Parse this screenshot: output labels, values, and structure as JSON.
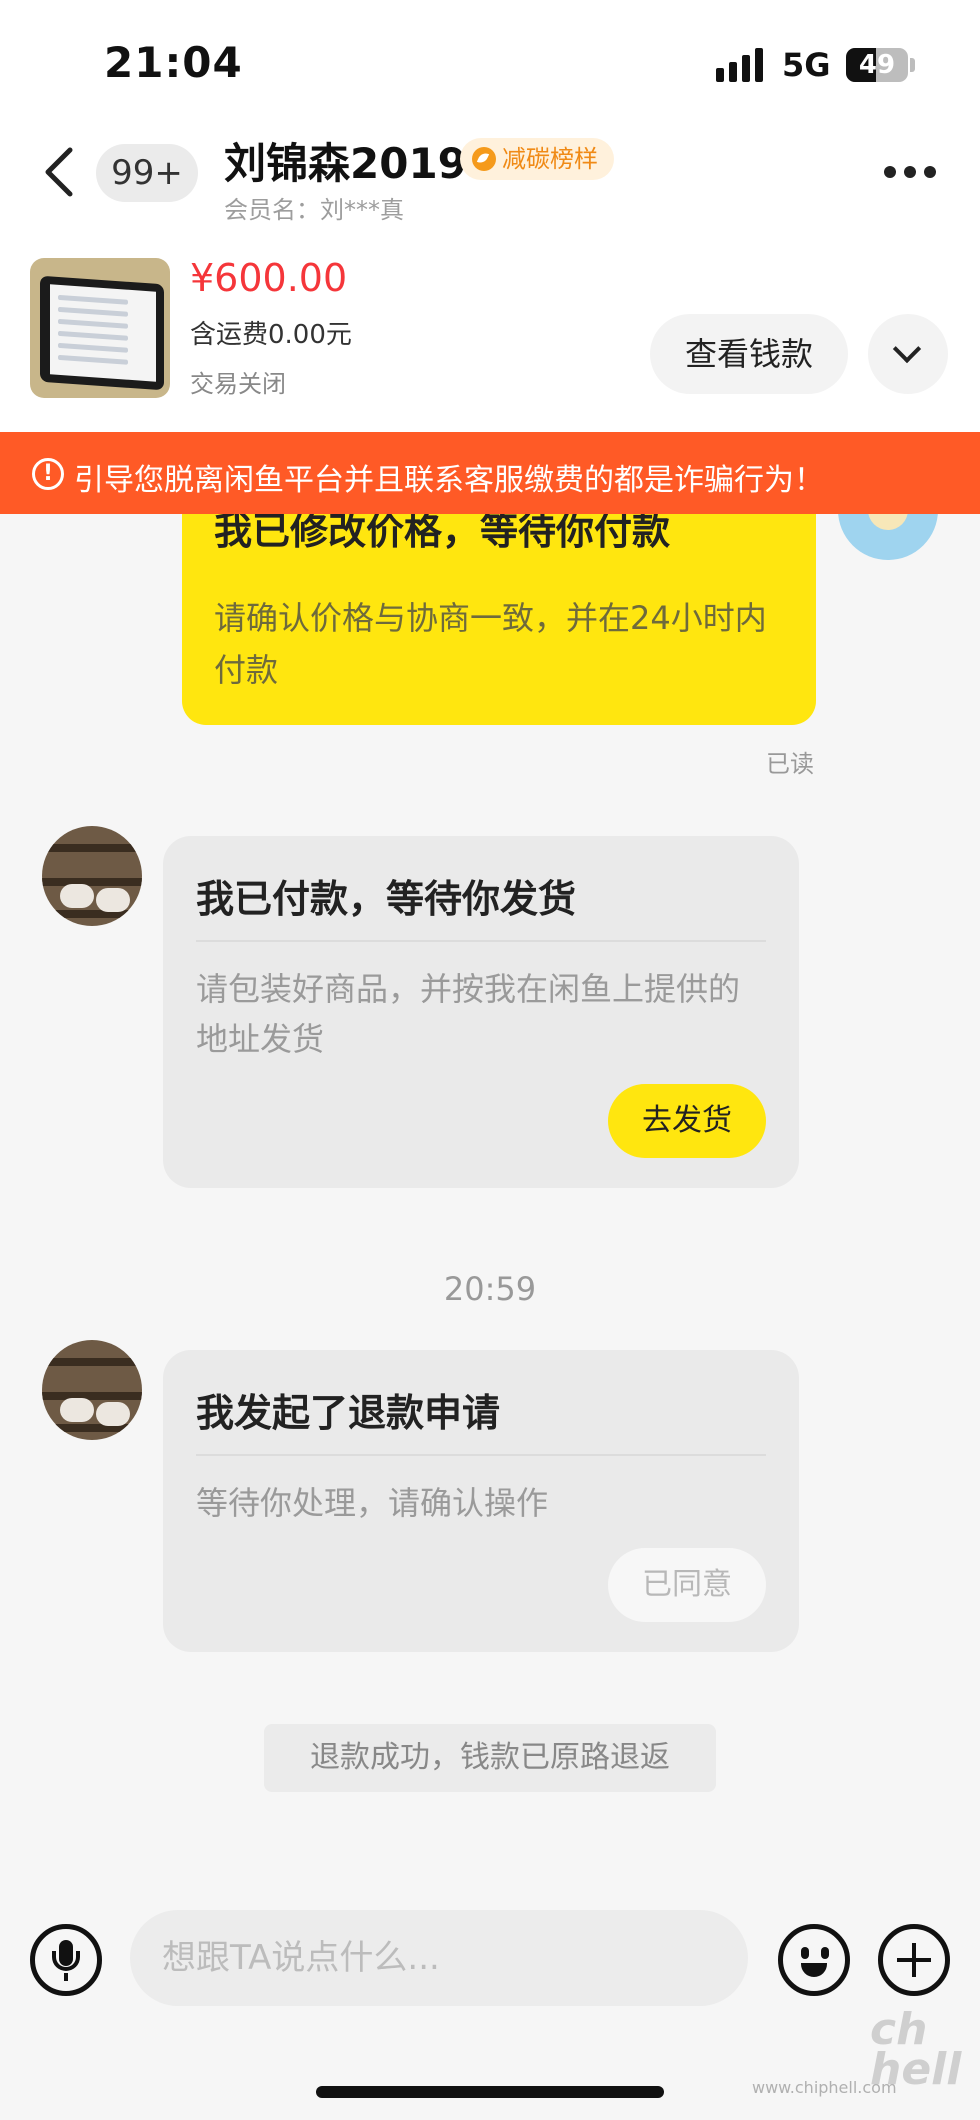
{
  "status_bar": {
    "time": "21:04",
    "network": "5G",
    "battery_level": "49"
  },
  "header": {
    "back_icon": "chevron-left-icon",
    "unread_badge": "99+",
    "contact_name": "刘锦森2019",
    "tag_label": "减碳榜样",
    "member_label": "会员名：刘***真",
    "more_icon": "more-horizontal-icon"
  },
  "product": {
    "price": "¥600.00",
    "shipping": "含运费0.00元",
    "status": "交易关闭",
    "view_payment_label": "查看钱款",
    "expand_icon": "chevron-down-icon"
  },
  "warning": {
    "icon": "!",
    "text": "引导您脱离闲鱼平台并且联系客服缴费的都是诈骗行为！"
  },
  "messages": [
    {
      "side": "right",
      "title": "我已修改价格，等待你付款",
      "text": "请确认价格与协商一致，并在24小时内付款",
      "read_status": "已读"
    },
    {
      "side": "left",
      "title": "我已付款，等待你发货",
      "text": "请包装好商品，并按我在闲鱼上提供的地址发货",
      "action_label": "去发货"
    },
    {
      "side": "left",
      "title": "我发起了退款申请",
      "text": "等待你处理，请确认操作",
      "action_label": "已同意"
    }
  ],
  "time_separator": "20:59",
  "system_notice": "退款成功，钱款已原路退返",
  "input_bar": {
    "placeholder": "想跟TA说点什么...",
    "mic_icon": "microphone-icon",
    "emoji_icon": "emoji-icon",
    "plus_icon": "plus-icon"
  },
  "watermark": {
    "logo": "chip hell",
    "url": "www.chiphell.com"
  },
  "colors": {
    "accent_yellow": "#ffe60f",
    "price_red": "#f5363a",
    "warning_orange": "#ff5a26",
    "tag_orange": "#f08a16"
  }
}
